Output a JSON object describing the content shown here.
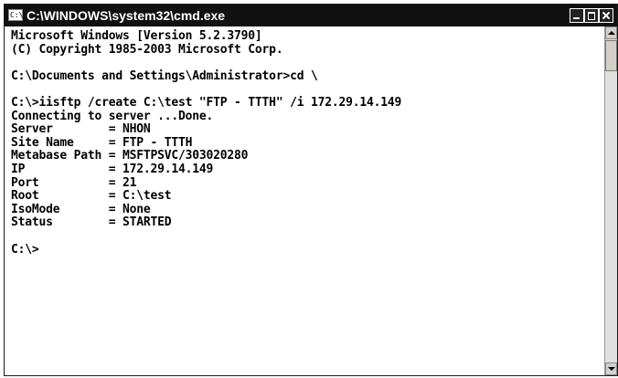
{
  "window": {
    "title": "C:\\WINDOWS\\system32\\cmd.exe",
    "icon_label": "C:\\",
    "controls": [
      "minimize-icon",
      "maximize-icon",
      "close-icon"
    ]
  },
  "console": {
    "lines": [
      "Microsoft Windows [Version 5.2.3790]",
      "(C) Copyright 1985-2003 Microsoft Corp.",
      "",
      "C:\\Documents and Settings\\Administrator>cd \\",
      "",
      "C:\\>iisftp /create C:\\test \"FTP - TTTH\" /i 172.29.14.149",
      "Connecting to server ...Done.",
      "Server        = NHON",
      "Site Name     = FTP - TTTH",
      "Metabase Path = MSFTPSVC/303020280",
      "IP            = 172.29.14.149",
      "Port          = 21",
      "Root          = C:\\test",
      "IsoMode       = None",
      "Status        = STARTED",
      "",
      "C:\\>"
    ]
  },
  "colors": {
    "titlebar": "#111111",
    "title_text": "#ffffff",
    "console_bg": "#ffffff",
    "console_text": "#000000"
  }
}
